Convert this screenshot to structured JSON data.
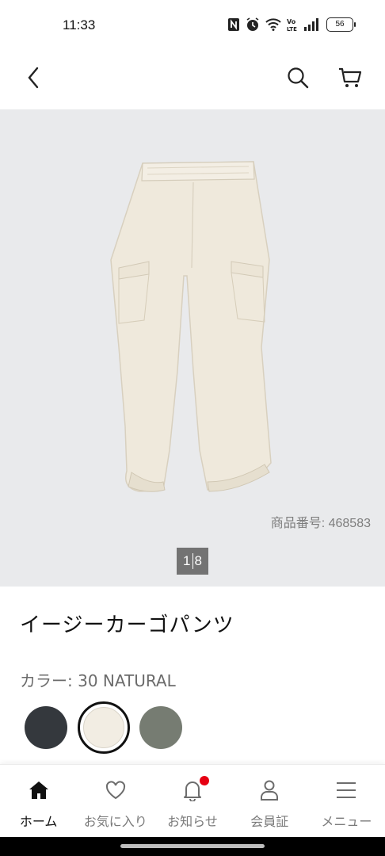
{
  "status_bar": {
    "time": "11:33",
    "battery": "56",
    "icons": [
      "nfc-icon",
      "alarm-icon",
      "wifi-icon",
      "volte-icon",
      "signal-icon",
      "battery-icon"
    ]
  },
  "top_nav": {
    "icons": [
      "back-icon",
      "search-icon",
      "cart-icon"
    ]
  },
  "product": {
    "number_text": "商品番号:  468583",
    "pager": {
      "current": "1",
      "total": "8"
    },
    "title": "イージーカーゴパンツ",
    "color_label": "カラー: 30 NATURAL",
    "colors": {
      "black": "#34383d",
      "natural": "#f2ede3",
      "olive": "#767c72"
    }
  },
  "tab_bar": {
    "items": [
      {
        "label": "ホーム",
        "icon": "home-icon"
      },
      {
        "label": "お気に入り",
        "icon": "heart-icon"
      },
      {
        "label": "お知らせ",
        "icon": "bell-icon"
      },
      {
        "label": "会員証",
        "icon": "person-icon"
      },
      {
        "label": "メニュー",
        "icon": "menu-icon"
      }
    ]
  },
  "colors": {
    "accent_badge": "#e60012",
    "hero_bg": "#e9eaec"
  }
}
